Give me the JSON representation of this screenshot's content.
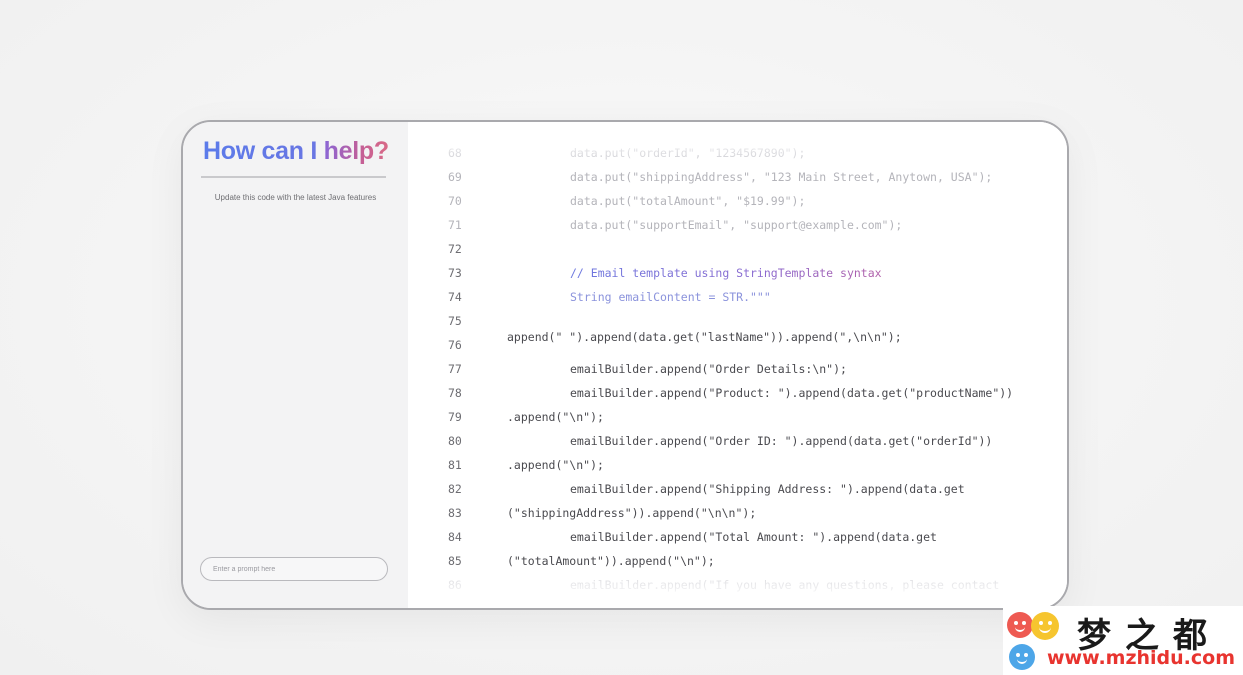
{
  "assistant": {
    "heading_part1": "How can I ",
    "heading_part2": "help?",
    "user_message": "Update this code with the latest Java features",
    "prompt_placeholder": "Enter a prompt here"
  },
  "code_lines": [
    {
      "num": "68",
      "text": "data.put(\"orderId\", \"1234567890\");"
    },
    {
      "num": "69",
      "text": "data.put(\"shippingAddress\", \"123 Main Street, Anytown, USA\");"
    },
    {
      "num": "70",
      "text": "data.put(\"totalAmount\", \"$19.99\");"
    },
    {
      "num": "71",
      "text": "data.put(\"supportEmail\", \"support@example.com\");"
    },
    {
      "num": "72",
      "text": ""
    },
    {
      "num": "73",
      "text": "// Email template using StringTemplate syntax"
    },
    {
      "num": "74",
      "text": "String emailContent = STR.\"\"\""
    },
    {
      "num": "75",
      "text": ""
    },
    {
      "num": "76",
      "text": "append(\" \").append(data.get(\"lastName\")).append(\",\\n\\n\");"
    },
    {
      "num": "77",
      "text": "emailBuilder.append(\"Order Details:\\n\");"
    },
    {
      "num": "78",
      "text": "emailBuilder.append(\"Product: \").append(data.get(\"productName\"))"
    },
    {
      "num": "79",
      "text": ".append(\"\\n\");"
    },
    {
      "num": "80",
      "text": "emailBuilder.append(\"Order ID: \").append(data.get(\"orderId\"))"
    },
    {
      "num": "81",
      "text": ".append(\"\\n\");"
    },
    {
      "num": "82",
      "text": "emailBuilder.append(\"Shipping Address: \").append(data.get"
    },
    {
      "num": "83",
      "text": "(\"shippingAddress\")).append(\"\\n\\n\");"
    },
    {
      "num": "84",
      "text": "emailBuilder.append(\"Total Amount: \").append(data.get"
    },
    {
      "num": "85",
      "text": "(\"totalAmount\")).append(\"\\n\");"
    },
    {
      "num": "86",
      "text": "emailBuilder.append(\"If you have any questions, please contact"
    }
  ],
  "watermark": {
    "title": "梦之都",
    "url": "www.mzhidu.com"
  }
}
